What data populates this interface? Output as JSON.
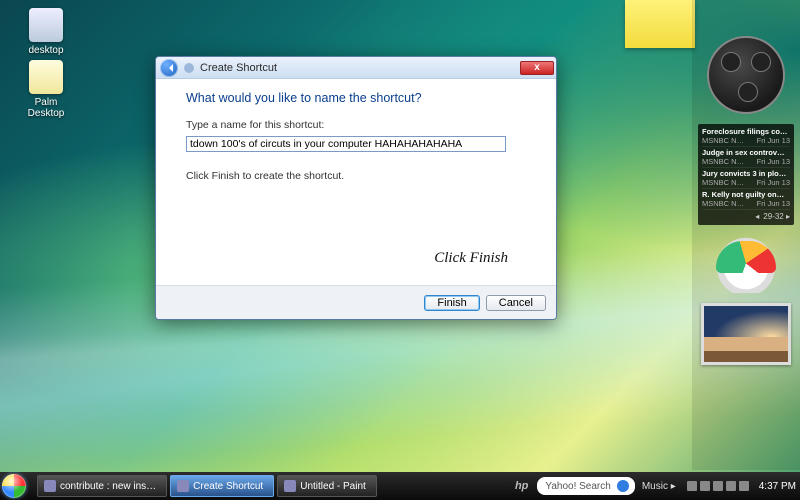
{
  "desktop": {
    "icons": [
      {
        "label": "desktop"
      },
      {
        "label": "Palm Desktop"
      }
    ]
  },
  "dialog": {
    "title": "Create Shortcut",
    "heading": "What would you like to name the shortcut?",
    "field_label": "Type a name for this shortcut:",
    "field_value": "tdown 100's of circuts in your computer HAHAHAHAHAHA",
    "hint": "Click Finish to create the shortcut.",
    "annotation": "Click   Finish",
    "finish": "Finish",
    "cancel": "Cancel",
    "close_glyph": "x"
  },
  "sidebar": {
    "feed": {
      "source": "MSNBC N…",
      "date": "Fri Jun 13",
      "items": [
        "Foreclosure filings co…",
        "Judge in sex controv…",
        "Jury convicts 3 in plo…",
        "R. Kelly not guilty on…"
      ],
      "nav": "29-32  ▸"
    }
  },
  "taskbar": {
    "items": [
      "contribute : new ins…",
      "Create Shortcut",
      "Untitled - Paint"
    ],
    "brand": "hp",
    "search_placeholder": "Yahoo! Search",
    "music": "Music ▸",
    "time": "4:37 PM"
  }
}
